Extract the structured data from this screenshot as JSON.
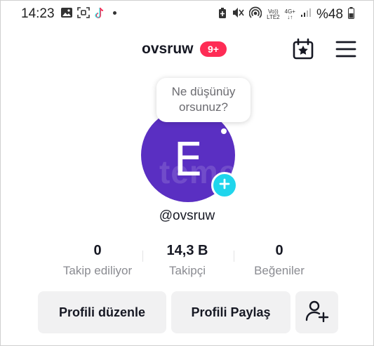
{
  "status_bar": {
    "time": "14:23",
    "battery_percent": "%48",
    "volte_line1": "Vo))",
    "volte_line2": "LTE2",
    "network_line1": "4G+",
    "network_line2": "↓↑",
    "icons": [
      "gallery-icon",
      "screenshot-icon",
      "tiktok-icon",
      "battery-saver-icon",
      "mute-icon",
      "hotspot-icon",
      "signal-icon",
      "battery-icon"
    ]
  },
  "header": {
    "username": "ovsruw",
    "badge": "9+",
    "icons": [
      "calendar-star-icon",
      "menu-icon"
    ]
  },
  "bubble": {
    "line1": "Ne düşünüy",
    "line2": "orsunuz?"
  },
  "avatar": {
    "letter": "E",
    "watermark": "teme",
    "color": "#5a2fc2"
  },
  "handle": "@ovsruw",
  "stats": [
    {
      "value": "0",
      "label": "Takip ediliyor"
    },
    {
      "value": "14,3 B",
      "label": "Takipçi"
    },
    {
      "value": "0",
      "label": "Beğeniler"
    }
  ],
  "buttons": {
    "edit": "Profili düzenle",
    "share": "Profili Paylaş",
    "add_friend_icon": "add-user-icon"
  },
  "colors": {
    "badge": "#fe2c55",
    "add_button": "#20d5ec",
    "button_bg": "#f1f1f2"
  }
}
